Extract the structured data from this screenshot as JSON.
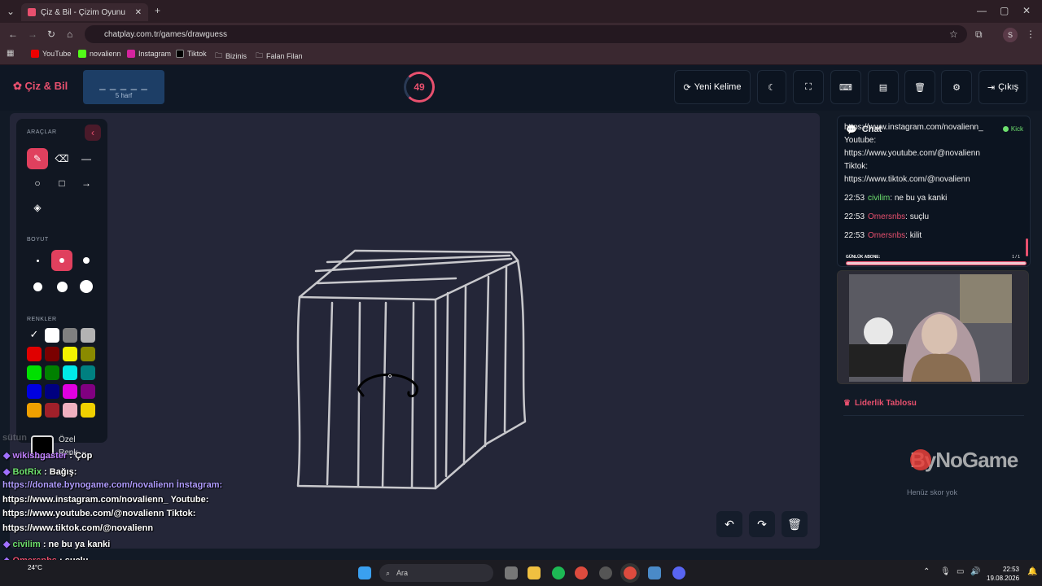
{
  "browser": {
    "tab_title": "Çiz & Bil - Çizim Oyunu",
    "url": "chatplay.com.tr/games/drawguess",
    "profile_initial": "S",
    "bookmarks": [
      "YouTube",
      "novalienn",
      "Instagram",
      "Tiktok",
      "Bizinis",
      "Falan Filan"
    ]
  },
  "header": {
    "logo": "Çiz & Bil",
    "word_mask": "_ _ _ _ _",
    "word_hint": "5 harf",
    "timer": "49",
    "new_word_label": "Yeni Kelime",
    "exit_label": "Çıkış"
  },
  "tools": {
    "title": "ARAÇLAR",
    "size_title": "BOYUT",
    "colors_title": "RENKLER",
    "custom_color_label": "Özel Renk",
    "colors": [
      "#000000",
      "#ffffff",
      "#808080",
      "#b3b3b3",
      "#e00000",
      "#7a0000",
      "#f2f200",
      "#8a8a00",
      "#00e000",
      "#008000",
      "#00e8e8",
      "#008080",
      "#0000e0",
      "#000080",
      "#e000e0",
      "#800080",
      "#f0a000",
      "#a0202a",
      "#f0b0c0",
      "#f0d000"
    ]
  },
  "chat": {
    "title": "Chat",
    "status": "Kick",
    "messages": [
      {
        "time": "",
        "user": "",
        "text": "https://www.instagram.com/novalienn_"
      },
      {
        "time": "",
        "user": "",
        "text": "Youtube:"
      },
      {
        "time": "",
        "user": "",
        "text": "https://www.youtube.com/@novalienn"
      },
      {
        "time": "",
        "user": "",
        "text": "Tiktok:"
      },
      {
        "time": "",
        "user": "",
        "text": "https://www.tiktok.com/@novalienn"
      },
      {
        "time": "22:53",
        "user": "civilim",
        "user_color": "#6ee06e",
        "text": "ne bu ya kanki"
      },
      {
        "time": "22:53",
        "user": "Omersnbs",
        "user_color": "#e8506e",
        "text": "suçlu"
      },
      {
        "time": "22:53",
        "user": "Omersnbs",
        "user_color": "#e8506e",
        "text": "kilit"
      }
    ],
    "sub_goal_label": "GÜNLÜK ABONE:",
    "sub_goal_count": "1 / 1",
    "sub_goal_progress": 1.0
  },
  "leaderboard": {
    "title": "Liderlik Tablosu",
    "empty_text": "Henüz skor yok",
    "watermark": "ByNoGame"
  },
  "overlay_chat": [
    {
      "user": "",
      "text": "sütun",
      "faded": true
    },
    {
      "user": "wikishgaster",
      "user_color": "#c080ff",
      "text": ": Çöp"
    },
    {
      "user": "BotRix",
      "user_color": "#6ee06e",
      "text": ": Bağış:"
    },
    {
      "user": "",
      "text": "https://donate.bynogame.com/novalienn İnstagram:"
    },
    {
      "user": "",
      "text": "https://www.instagram.com/novalienn_ Youtube:"
    },
    {
      "user": "",
      "text": "https://www.youtube.com/@novalienn Tiktok:"
    },
    {
      "user": "",
      "text": "https://www.tiktok.com/@novalienn"
    },
    {
      "user": "civilim",
      "user_color": "#6ee06e",
      "text": ": ne bu ya kanki"
    },
    {
      "user": "Omersnbs",
      "user_color": "#e8506e",
      "text": ": suçlu"
    },
    {
      "user": "Omersnbs",
      "user_color": "#e8506e",
      "text": ": kilit"
    }
  ],
  "taskbar": {
    "search_placeholder": "Ara",
    "weather": "24°C",
    "time": "22:53",
    "date": "19.08.2026"
  }
}
